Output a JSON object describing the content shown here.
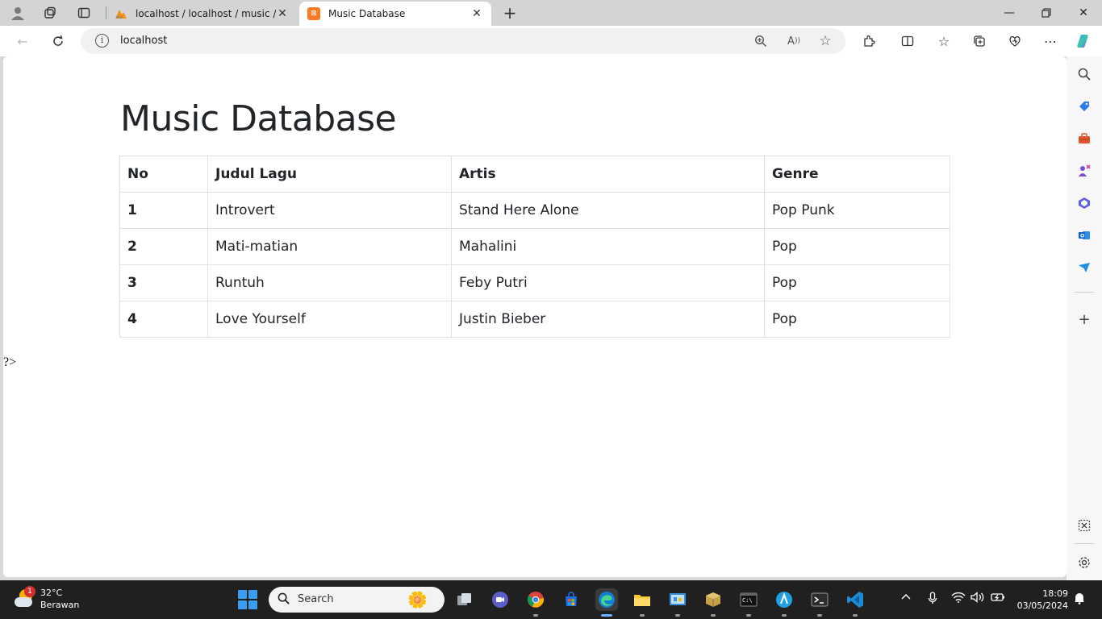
{
  "browser": {
    "tabs": [
      {
        "title": "localhost / localhost / music / mu",
        "favicon": "phpmyadmin-icon",
        "active": false
      },
      {
        "title": "Music Database",
        "favicon": "xampp-icon",
        "active": true
      }
    ],
    "address": "localhost"
  },
  "page": {
    "heading": "Music Database",
    "table": {
      "headers": [
        "No",
        "Judul Lagu",
        "Artis",
        "Genre"
      ],
      "rows": [
        {
          "no": "1",
          "judul": "Introvert",
          "artis": "Stand Here Alone",
          "genre": "Pop Punk"
        },
        {
          "no": "2",
          "judul": "Mati-matian",
          "artis": "Mahalini",
          "genre": "Pop"
        },
        {
          "no": "3",
          "judul": "Runtuh",
          "artis": "Feby Putri",
          "genre": "Pop"
        },
        {
          "no": "4",
          "judul": "Love Yourself",
          "artis": "Justin Bieber",
          "genre": "Pop"
        }
      ]
    },
    "stray_text": "?>"
  },
  "taskbar": {
    "weather": {
      "temp": "32°C",
      "condition": "Berawan",
      "badge": "1"
    },
    "search_placeholder": "Search",
    "time": "18:09",
    "date": "03/05/2024"
  },
  "colors": {
    "accent": "#0d6efd",
    "table_border": "#dee2e6",
    "text": "#212529",
    "taskbar_bg": "#202020"
  }
}
